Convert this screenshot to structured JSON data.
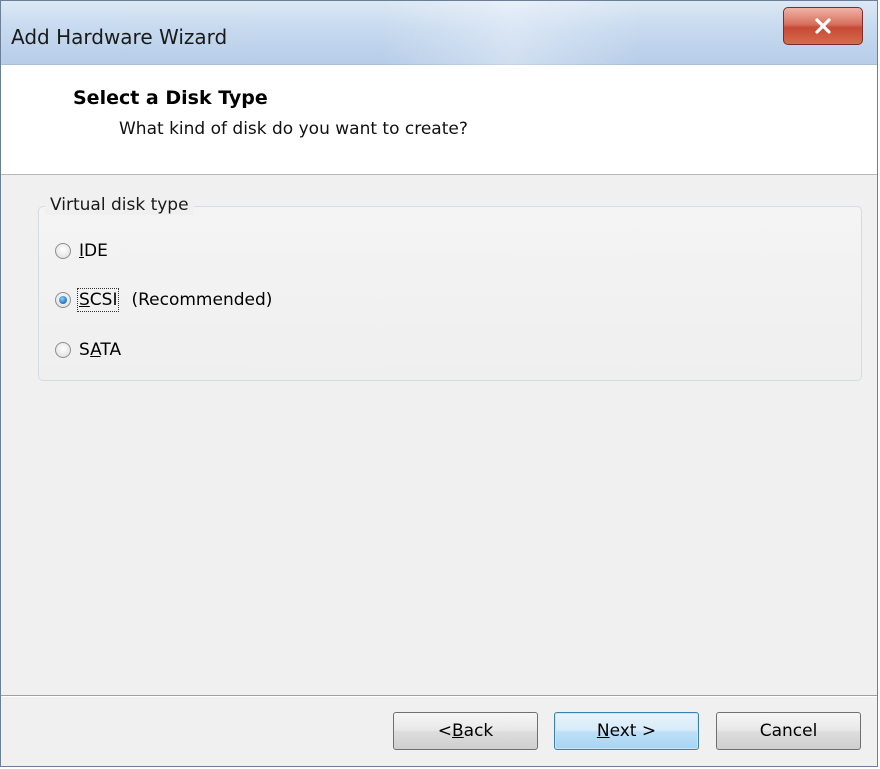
{
  "window": {
    "title": "Add Hardware Wizard",
    "close_icon": "close-icon"
  },
  "header": {
    "title": "Select a Disk Type",
    "subtitle": "What kind of disk do you want to create?"
  },
  "group": {
    "legend": "Virtual disk type",
    "options": [
      {
        "label_pre": "",
        "label_ul": "I",
        "label_post": "DE",
        "extra": "",
        "checked": false
      },
      {
        "label_pre": "",
        "label_ul": "S",
        "label_post": "CSI",
        "extra": "(Recommended)",
        "checked": true
      },
      {
        "label_pre": "S",
        "label_ul": "A",
        "label_post": "TA",
        "extra": "",
        "checked": false
      }
    ]
  },
  "buttons": {
    "back": {
      "pre": "< ",
      "ul": "B",
      "post": "ack"
    },
    "next": {
      "pre": "",
      "ul": "N",
      "post": "ext >"
    },
    "cancel": "Cancel"
  },
  "colors": {
    "title_bar": "#c6d9ef",
    "close_button": "#c64a35",
    "radio_checked": "#2d7fc7",
    "default_button": "#bfe0f7"
  }
}
